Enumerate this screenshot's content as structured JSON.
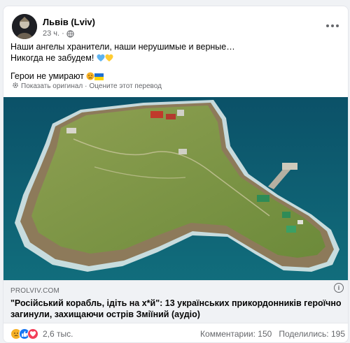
{
  "post": {
    "author": "Львів (Lviv)",
    "time": "23 ч.",
    "separator": "·",
    "privacy_icon": "globe-icon",
    "menu_icon": "more-horizontal-icon",
    "text_lines": [
      "Наши ангелы хранители, наши нерушимые и верные…",
      "Никогда не забудем!",
      "Герои не умирают"
    ],
    "translation": {
      "show_original": "Показать оригинал",
      "dot": "·",
      "rate": "Оцените этот перевод"
    }
  },
  "link_preview": {
    "domain": "PROLVIV.COM",
    "headline": "\"Російський корабль, ідіть на х*й\": 13 українських прикордонників героїчно загинули, захищаючи острів Зміїний (аудіо)",
    "info_icon": "info-icon"
  },
  "footer": {
    "reaction_icons": [
      "sad-reaction-icon",
      "like-reaction-icon",
      "love-reaction-icon"
    ],
    "reaction_count": "2,6 тыс.",
    "comments": "Комментарии: 150",
    "shares": "Поделились: 195"
  },
  "colors": {
    "like": "#1877f2",
    "love": "#f33e58",
    "sad": "#f7b125",
    "link": "#65676b"
  }
}
